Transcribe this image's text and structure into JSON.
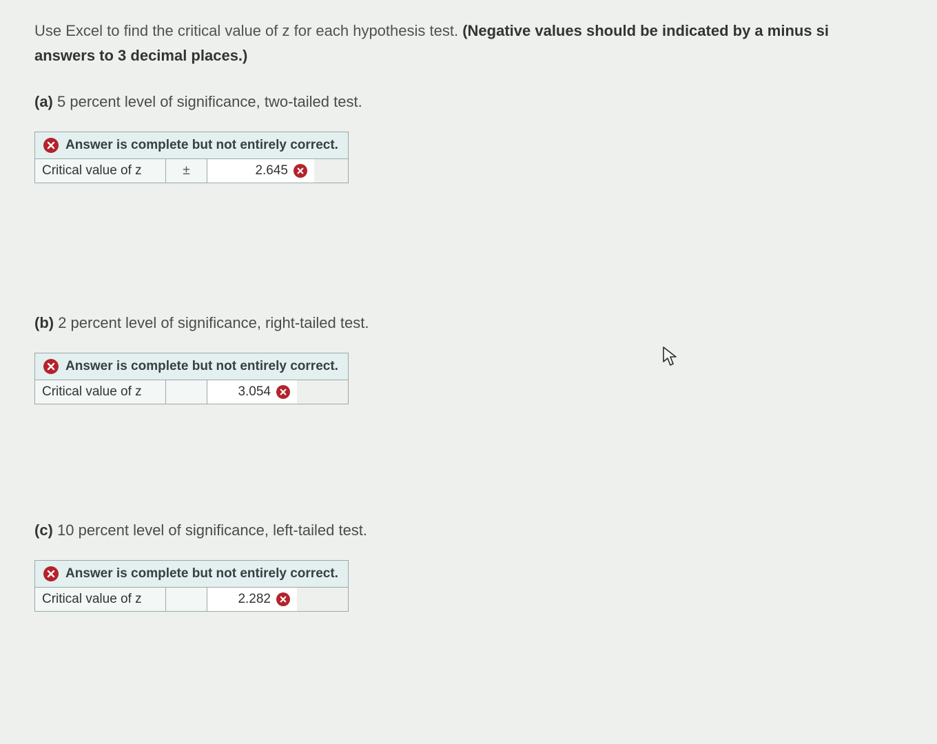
{
  "intro": {
    "plain": "Use Excel to find the critical value of z for each hypothesis test. ",
    "bold1": "(Negative values should be indicated by a minus si",
    "bold2": "answers to 3 decimal places.)"
  },
  "answer_header": "Answer is complete but not entirely correct.",
  "row_label": "Critical value of z",
  "parts": {
    "a": {
      "label": "(a)",
      "text": " 5 percent level of significance, two-tailed test.",
      "sign": "±",
      "value": "2.645"
    },
    "b": {
      "label": "(b)",
      "text": " 2 percent level of significance, right-tailed test.",
      "value": "3.054"
    },
    "c": {
      "label": "(c)",
      "text": " 10 percent level of significance, left-tailed test.",
      "value": "2.282"
    }
  }
}
